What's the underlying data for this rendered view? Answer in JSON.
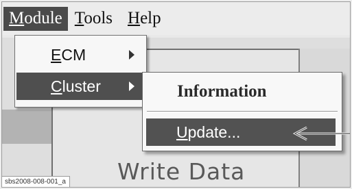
{
  "menubar": {
    "items": [
      {
        "label_u": "M",
        "label_rest": "odule",
        "active": true
      },
      {
        "label_u": "T",
        "label_rest": "ools",
        "active": false
      },
      {
        "label_u": "H",
        "label_rest": "elp",
        "active": false
      }
    ]
  },
  "module_menu": {
    "items": [
      {
        "label_u": "E",
        "label_rest": "CM",
        "has_submenu": true,
        "selected": false
      },
      {
        "label_u": "C",
        "label_rest": "luster",
        "has_submenu": true,
        "selected": true
      }
    ]
  },
  "cluster_submenu": {
    "information_label": "Information",
    "update_label_u": "U",
    "update_label_rest": "pdate..."
  },
  "background": {
    "big_text": "Write Data"
  },
  "caption": "sbs2008-008-001_a",
  "colors": {
    "highlight": "#4f4f4f",
    "menu_bg": "#f7f7f7"
  },
  "icons": [
    "submenu-arrow-icon",
    "callout-arrow-icon"
  ]
}
